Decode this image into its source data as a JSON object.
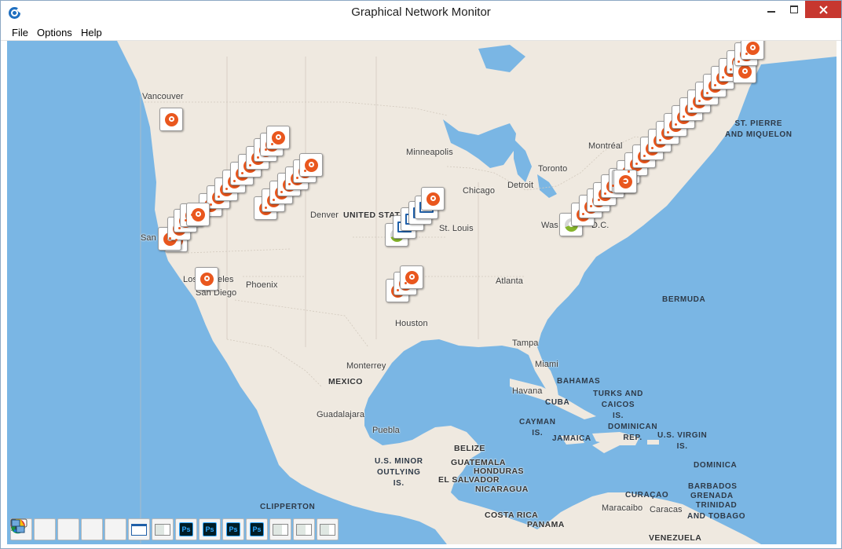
{
  "window": {
    "title": "Graphical Network Monitor"
  },
  "menu": {
    "file": "File",
    "options": "Options",
    "help": "Help"
  },
  "map": {
    "cities": {
      "vancouver": "Vancouver",
      "minneapolis": "Minneapolis",
      "montreal": "Montréal",
      "toronto": "Toronto",
      "chicago": "Chicago",
      "detroit": "Detroit",
      "denver": "Denver",
      "st_louis": "St. Louis",
      "washington": "Was",
      "dc": "D.C.",
      "san": "San",
      "los_angeles_a": "Los",
      "los_angeles_b": "eles",
      "san_diego": "San Diego",
      "phoenix": "Phoenix",
      "atlanta": "Atlanta",
      "houston": "Houston",
      "tampa": "Tampa",
      "miami": "Miami",
      "monterrey": "Monterrey",
      "havana": "Havana",
      "guadalajara": "Guadalajara",
      "puebla": "Puebla",
      "maracaibo": "Maracaibo",
      "caracas": "Caracas"
    },
    "countries": {
      "united_states": "UNITED STAT",
      "mexico": "MEXICO",
      "bahamas": "BAHAMAS",
      "cuba": "CUBA",
      "turks_caicos": "TURKS AND\nCAICOS\nIS.",
      "cayman": "CAYMAN\nIS.",
      "jamaica": "JAMAICA",
      "dominican": "DOMINICAN\nREP.",
      "usvi": "U.S. VIRGIN\nIS.",
      "belize": "BELIZE",
      "guatemala": "GUATEMALA",
      "honduras": "HONDURAS",
      "el_salvador": "EL SALVADOR",
      "nicaragua": "NICARAGUA",
      "costa_rica": "COSTA RICA",
      "panama": "PANAMA",
      "us_minor": "U.S. MINOR\nOUTLYING\nIS.",
      "clipperton": "CLIPPERTON",
      "dominica": "DOMINICA",
      "barbados": "BARBADOS",
      "grenada": "GRENADA",
      "trinidad": "TRINIDAD\nAND TOBAGO",
      "curacao": "CURAÇAO",
      "venezuela": "VENEZUELA",
      "bermuda": "BERMUDA",
      "st_pierre": "ST. PIERRE\nAND MIQUELON"
    }
  },
  "taskbar": {
    "items": [
      "chat-icon",
      "chrome-icon",
      "google-drive-icon",
      "google-drive-icon",
      "network-icon",
      "window-icon",
      "app-window-icon",
      "photoshop-icon",
      "photoshop-icon",
      "photoshop-icon",
      "photoshop-icon",
      "app-window-icon",
      "app-window-icon",
      "app-window-icon"
    ],
    "ps_label": "Ps"
  },
  "colors": {
    "water": "#7ab6e4",
    "land": "#efe9e0",
    "marker": "#e9571e",
    "close": "#c7372f"
  }
}
